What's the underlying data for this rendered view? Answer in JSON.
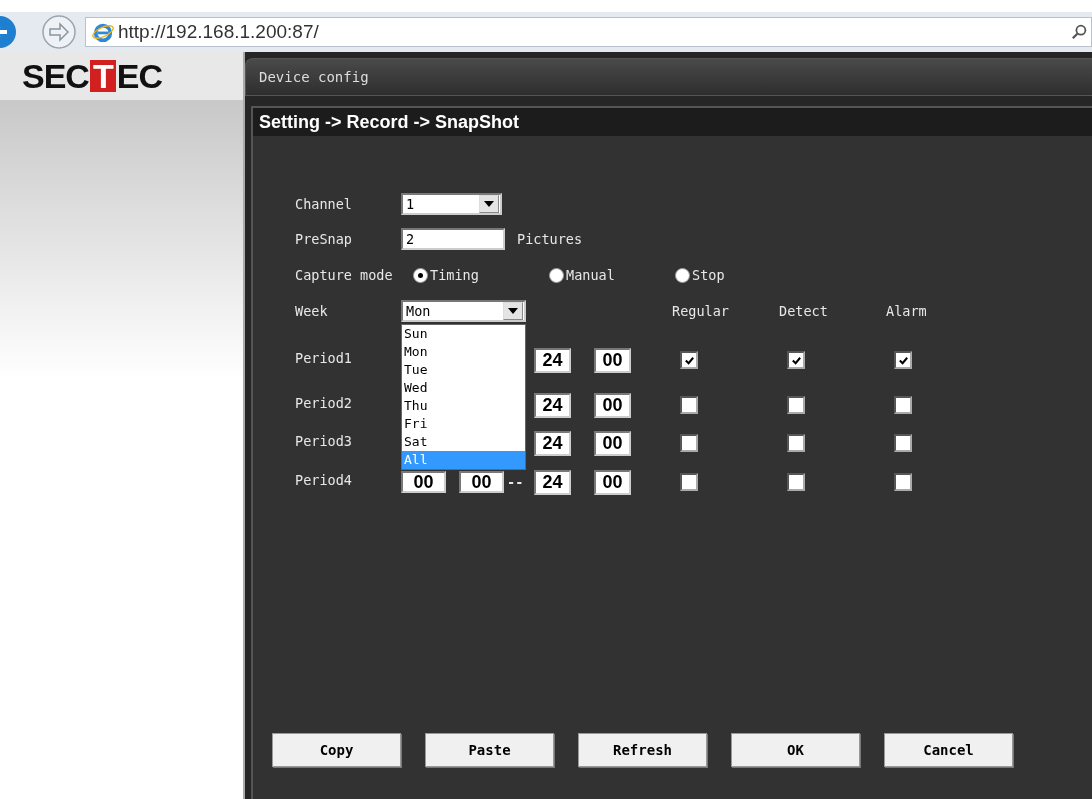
{
  "browser": {
    "address": "http://192.168.1.200:87/"
  },
  "logo": {
    "lead": "SEC",
    "boxed": "T",
    "tail": "EC"
  },
  "tab": {
    "label": "Device config"
  },
  "breadcrumb": "Setting -> Record -> SnapShot",
  "channel": {
    "label": "Channel",
    "value": "1"
  },
  "presnap": {
    "label": "PreSnap",
    "value": "2",
    "unit": "Pictures"
  },
  "capture_mode": {
    "label": "Capture mode",
    "options": [
      {
        "label": "Timing",
        "selected": true
      },
      {
        "label": "Manual",
        "selected": false
      },
      {
        "label": "Stop",
        "selected": false
      }
    ]
  },
  "week": {
    "label": "Week",
    "value": "Mon",
    "options": [
      {
        "label": "Sun",
        "highlighted": false
      },
      {
        "label": "Mon",
        "highlighted": false
      },
      {
        "label": "Tue",
        "highlighted": false
      },
      {
        "label": "Wed",
        "highlighted": false
      },
      {
        "label": "Thu",
        "highlighted": false
      },
      {
        "label": "Fri",
        "highlighted": false
      },
      {
        "label": "Sat",
        "highlighted": false
      },
      {
        "label": "All",
        "highlighted": true
      }
    ]
  },
  "columns": [
    "Regular",
    "Detect",
    "Alarm"
  ],
  "periods": [
    {
      "label": "Period1",
      "end_hour": "24",
      "end_minute": "00",
      "regular": true,
      "detect": true,
      "alarm": true
    },
    {
      "label": "Period2",
      "end_hour": "24",
      "end_minute": "00",
      "regular": false,
      "detect": false,
      "alarm": false
    },
    {
      "label": "Period3",
      "end_hour": "24",
      "end_minute": "00",
      "regular": false,
      "detect": false,
      "alarm": false
    },
    {
      "label": "Period4",
      "start_hour": "00",
      "start_minute": "00",
      "separator": "--",
      "end_hour": "24",
      "end_minute": "00",
      "regular": false,
      "detect": false,
      "alarm": false
    }
  ],
  "buttons": [
    "Copy",
    "Paste",
    "Refresh",
    "OK",
    "Cancel"
  ]
}
